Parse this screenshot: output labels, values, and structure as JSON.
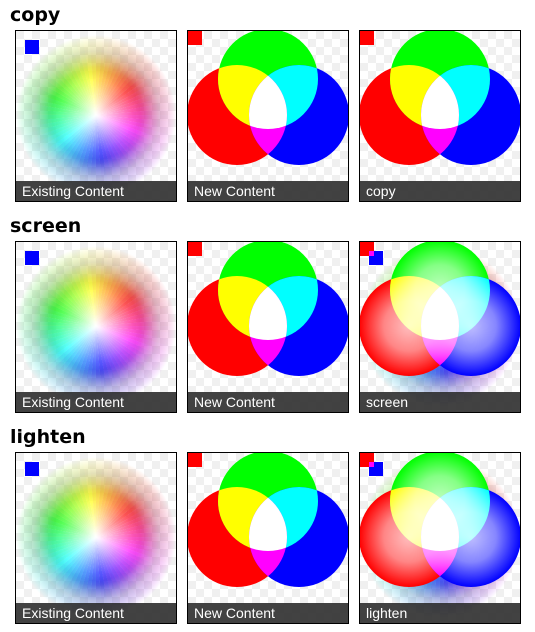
{
  "sections": [
    {
      "title": "copy",
      "captions": [
        "Existing Content",
        "New Content",
        "copy"
      ]
    },
    {
      "title": "screen",
      "captions": [
        "Existing Content",
        "New Content",
        "screen"
      ]
    },
    {
      "title": "lighten",
      "captions": [
        "Existing Content",
        "New Content",
        "lighten"
      ]
    }
  ],
  "colors": {
    "square_existing": "#0000ff",
    "square_new": "#ff0000",
    "circle_red": "#ff0000",
    "circle_green": "#00ff00",
    "circle_blue": "#0000ff",
    "overlap_yellow": "#ffff00",
    "overlap_cyan": "#00ffff",
    "overlap_magenta": "#ff00ff",
    "overlap_white": "#ffffff"
  }
}
